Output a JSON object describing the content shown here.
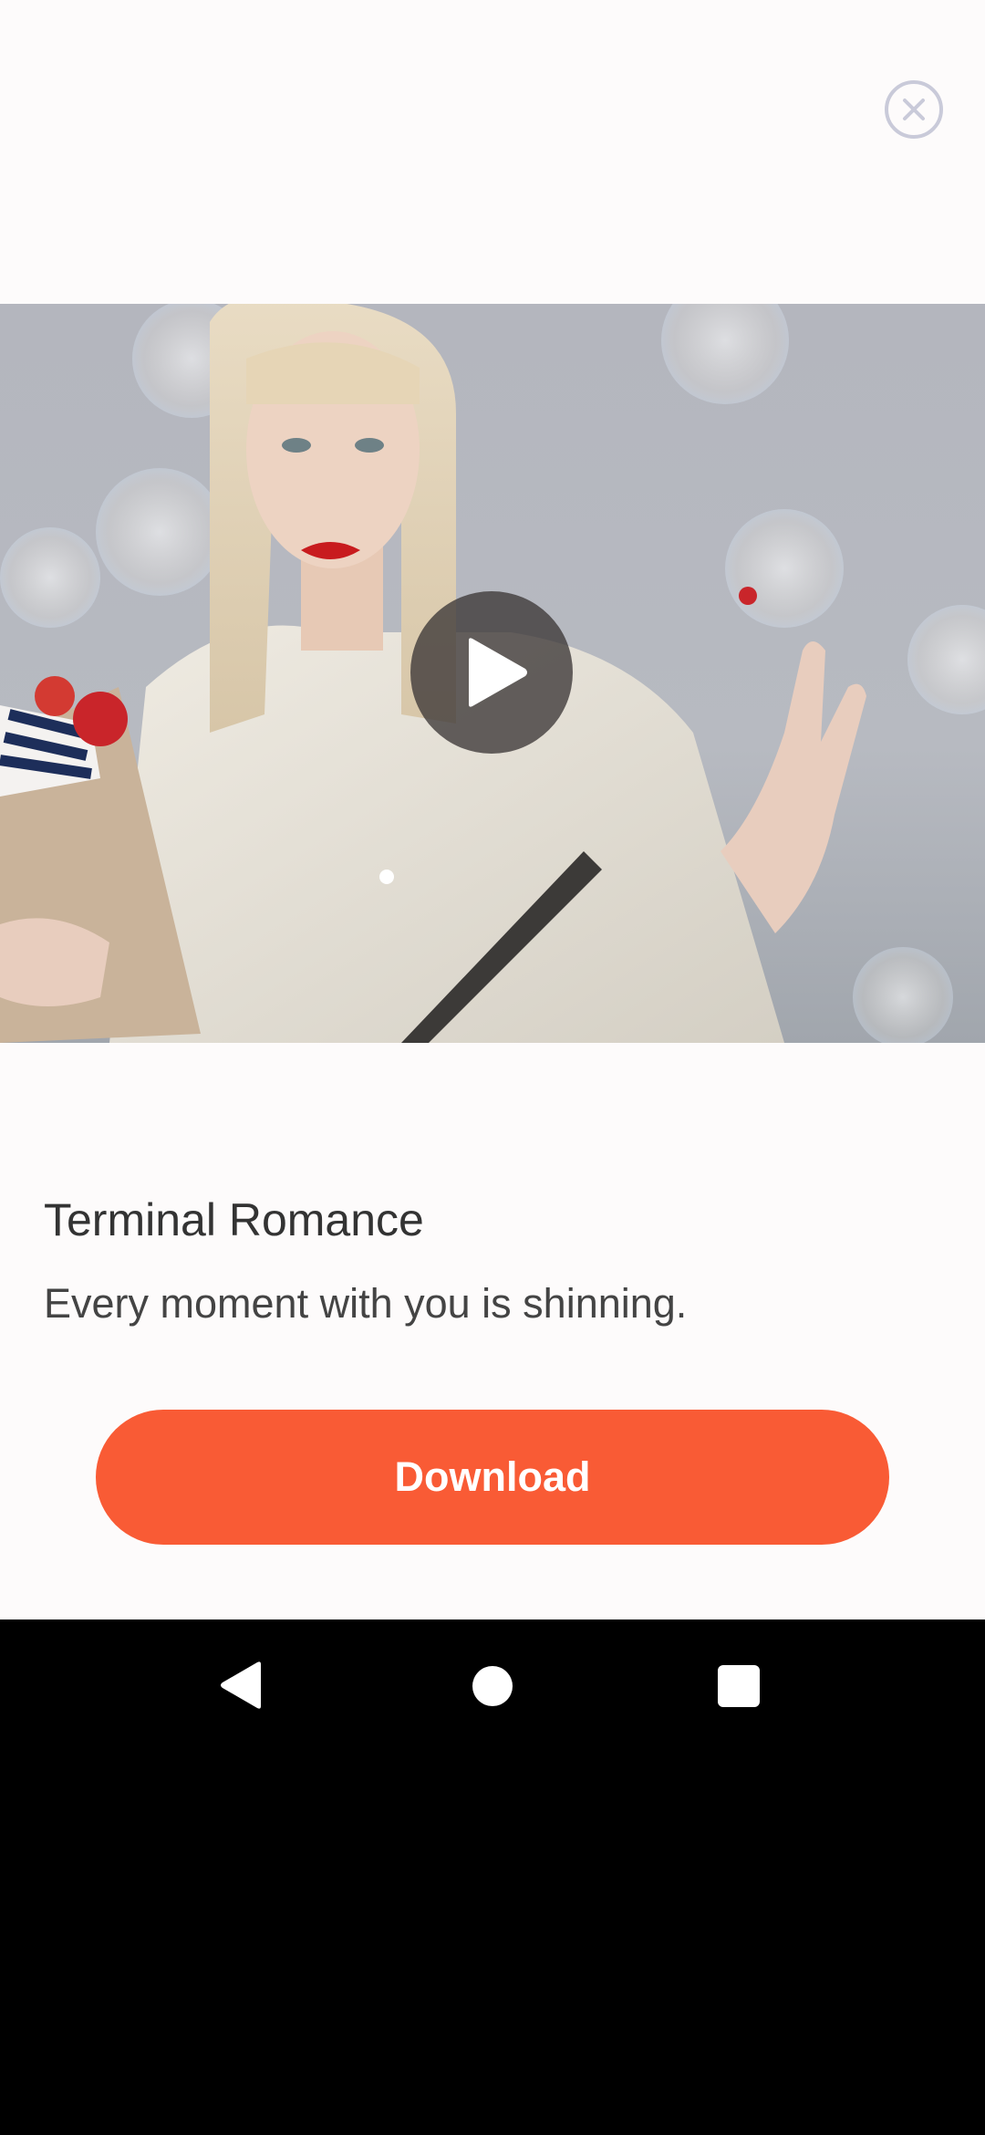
{
  "ad": {
    "title": "Terminal Romance",
    "subtitle": "Every moment with you is shinning.",
    "cta_label": "Download",
    "accent_color": "#F95B35"
  },
  "icons": {
    "close": "close-circle-icon",
    "play": "play-icon",
    "nav_back": "back-triangle-icon",
    "nav_home": "home-circle-icon",
    "nav_recents": "recents-square-icon"
  }
}
